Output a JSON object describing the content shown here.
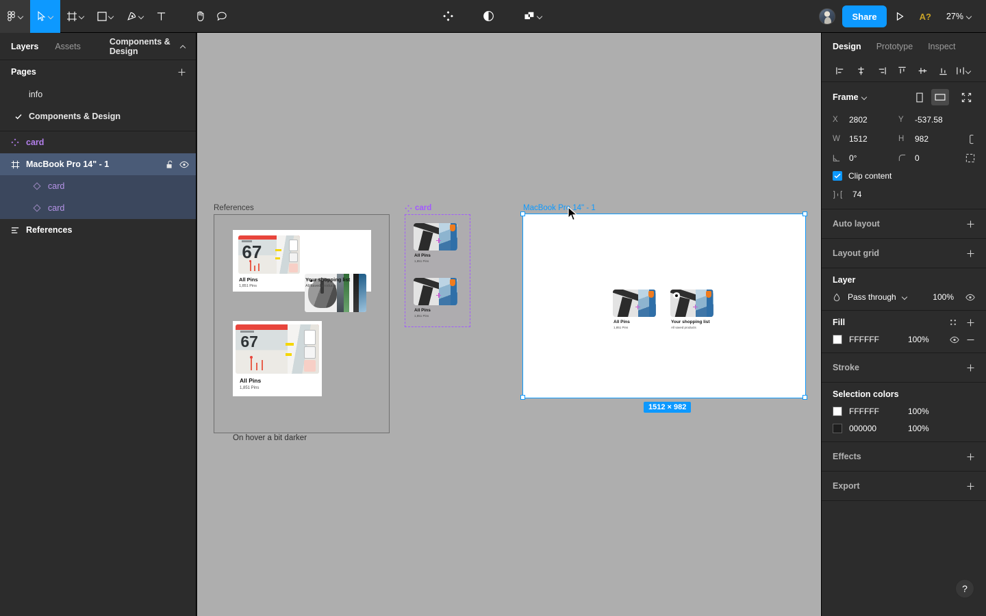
{
  "toolbar": {
    "left_tools": [
      {
        "name": "figma-menu-icon",
        "label": "",
        "has_chevron": true,
        "active": false
      },
      {
        "name": "move-tool-icon",
        "label": "",
        "has_chevron": true,
        "active": true
      },
      {
        "name": "frame-tool-icon",
        "label": "",
        "has_chevron": true,
        "active": false
      },
      {
        "name": "shape-tool-icon",
        "label": "",
        "has_chevron": true,
        "active": false
      },
      {
        "name": "pen-tool-icon",
        "label": "",
        "has_chevron": true,
        "active": false
      },
      {
        "name": "text-tool-icon",
        "label": "",
        "has_chevron": false,
        "active": false
      },
      {
        "name": "hand-tool-icon",
        "label": "",
        "has_chevron": false,
        "active": false
      },
      {
        "name": "comment-tool-icon",
        "label": "",
        "has_chevron": false,
        "active": false
      }
    ],
    "center_tools": [
      {
        "name": "components-icon",
        "has_chevron": false
      },
      {
        "name": "mask-contrast-icon",
        "has_chevron": false
      },
      {
        "name": "boolean-union-icon",
        "has_chevron": true
      }
    ],
    "share_label": "Share",
    "ai_badge": "A?",
    "zoom_level": "27%",
    "accent": "#0d99ff"
  },
  "left_panel": {
    "tabs": [
      {
        "label": "Layers",
        "active": true
      },
      {
        "label": "Assets",
        "active": false
      }
    ],
    "page_selector": "Components & Design",
    "pages_header": "Pages",
    "pages": [
      {
        "label": "info",
        "selected": false
      },
      {
        "label": "Components & Design",
        "selected": true
      }
    ],
    "layers": [
      {
        "label": "card",
        "type": "component",
        "indent": 0,
        "state": "component"
      },
      {
        "label": "MacBook Pro 14\" - 1",
        "type": "frame",
        "indent": 0,
        "state": "selected",
        "locked_icon": "unlock-icon",
        "visible_icon": "eye-icon"
      },
      {
        "label": "card",
        "type": "instance",
        "indent": 1,
        "state": "child-selected"
      },
      {
        "label": "card",
        "type": "instance",
        "indent": 1,
        "state": "child-selected"
      },
      {
        "label": "References",
        "type": "section",
        "indent": 0,
        "state": "normal"
      }
    ]
  },
  "canvas": {
    "background": "#aeaeae",
    "section": {
      "title": "References",
      "cards": [
        {
          "title_left": "All Pins",
          "sub_left": "1,851 Pins",
          "title_right": "Your shopping list",
          "sub_right": "All saved products"
        },
        {
          "title_left": "All Pins",
          "sub_left": "1,851 Pins",
          "caption": "On hover a bit darker"
        }
      ]
    },
    "component_set": {
      "title": "card",
      "variants": [
        {
          "title": "All Pins",
          "sub": "1,851 Pins"
        },
        {
          "title": "All Pins",
          "sub": "1,851 Pins"
        }
      ]
    },
    "selected_frame": {
      "title": "MacBook Pro 14\" - 1",
      "size_badge": "1512 × 982",
      "cards": [
        {
          "title": "All Pins",
          "sub": "1,851 Pins"
        },
        {
          "title": "Your shopping list",
          "sub": "All saved products"
        }
      ]
    }
  },
  "right_panel": {
    "tabs": [
      {
        "label": "Design",
        "active": true
      },
      {
        "label": "Prototype",
        "active": false
      },
      {
        "label": "Inspect",
        "active": false
      }
    ],
    "align_buttons": [
      "align-left-icon",
      "align-horizontal-center-icon",
      "align-right-icon",
      "align-top-icon",
      "align-vertical-center-icon",
      "align-bottom-icon",
      "distribute-icon"
    ],
    "frame_section": {
      "title": "Frame",
      "orientation_portrait": "portrait-icon",
      "orientation_landscape": "landscape-icon",
      "resize_to_fit": "resize-to-fit-icon",
      "x_key": "X",
      "x_value": "2802",
      "y_key": "Y",
      "y_value": "-537.58",
      "w_key": "W",
      "w_value": "1512",
      "h_key": "H",
      "h_value": "982",
      "rotation_value": "0°",
      "corner_radius_value": "0",
      "clip_content_label": "Clip content",
      "clip_content_checked": true,
      "spacing_value": "74"
    },
    "auto_layout": {
      "title": "Auto layout",
      "action": "add"
    },
    "layout_grid": {
      "title": "Layout grid",
      "action": "add"
    },
    "layer": {
      "title": "Layer",
      "blend_mode": "Pass through",
      "opacity": "100%"
    },
    "fill": {
      "title": "Fill",
      "items": [
        {
          "hex": "FFFFFF",
          "opacity": "100%",
          "color": "#FFFFFF"
        }
      ]
    },
    "stroke": {
      "title": "Stroke"
    },
    "selection_colors": {
      "title": "Selection colors",
      "items": [
        {
          "hex": "FFFFFF",
          "opacity": "100%",
          "color": "#FFFFFF"
        },
        {
          "hex": "000000",
          "opacity": "100%",
          "color": "#1e1e1e"
        }
      ]
    },
    "effects": {
      "title": "Effects"
    },
    "export": {
      "title": "Export"
    },
    "help_label": "?"
  }
}
